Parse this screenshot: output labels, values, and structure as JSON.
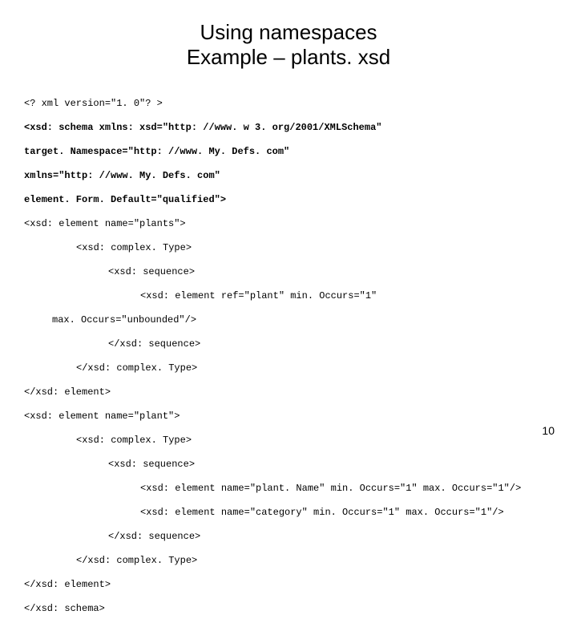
{
  "title_line1": "Using namespaces",
  "title_line2": "Example – plants. xsd",
  "code": {
    "l1": "<? xml version=\"1. 0\"? >",
    "l2": "<xsd: schema xmlns: xsd=\"http: //www. w 3. org/2001/XMLSchema\"",
    "l3": "target. Namespace=\"http: //www. My. Defs. com\"",
    "l4": "xmlns=\"http: //www. My. Defs. com\"",
    "l5": "element. Form. Default=\"qualified\">",
    "l6": "<xsd: element name=\"plants\">",
    "l7": "<xsd: complex. Type>",
    "l8": "<xsd: sequence>",
    "l9": "<xsd: element ref=\"plant\" min. Occurs=\"1\"",
    "l9b": "max. Occurs=\"unbounded\"/>",
    "l10": "</xsd: sequence>",
    "l11": "</xsd: complex. Type>",
    "l12": "</xsd: element>",
    "l13": "<xsd: element name=\"plant\">",
    "l14": "<xsd: complex. Type>",
    "l15": "<xsd: sequence>",
    "l16": "<xsd: element name=\"plant. Name\" min. Occurs=\"1\" max. Occurs=\"1\"/>",
    "l17": "<xsd: element name=\"category\" min. Occurs=\"1\" max. Occurs=\"1\"/>",
    "l18": "</xsd: sequence>",
    "l19": "</xsd: complex. Type>",
    "l20": "</xsd: element>",
    "l21": "</xsd: schema>"
  },
  "page_number": "10"
}
